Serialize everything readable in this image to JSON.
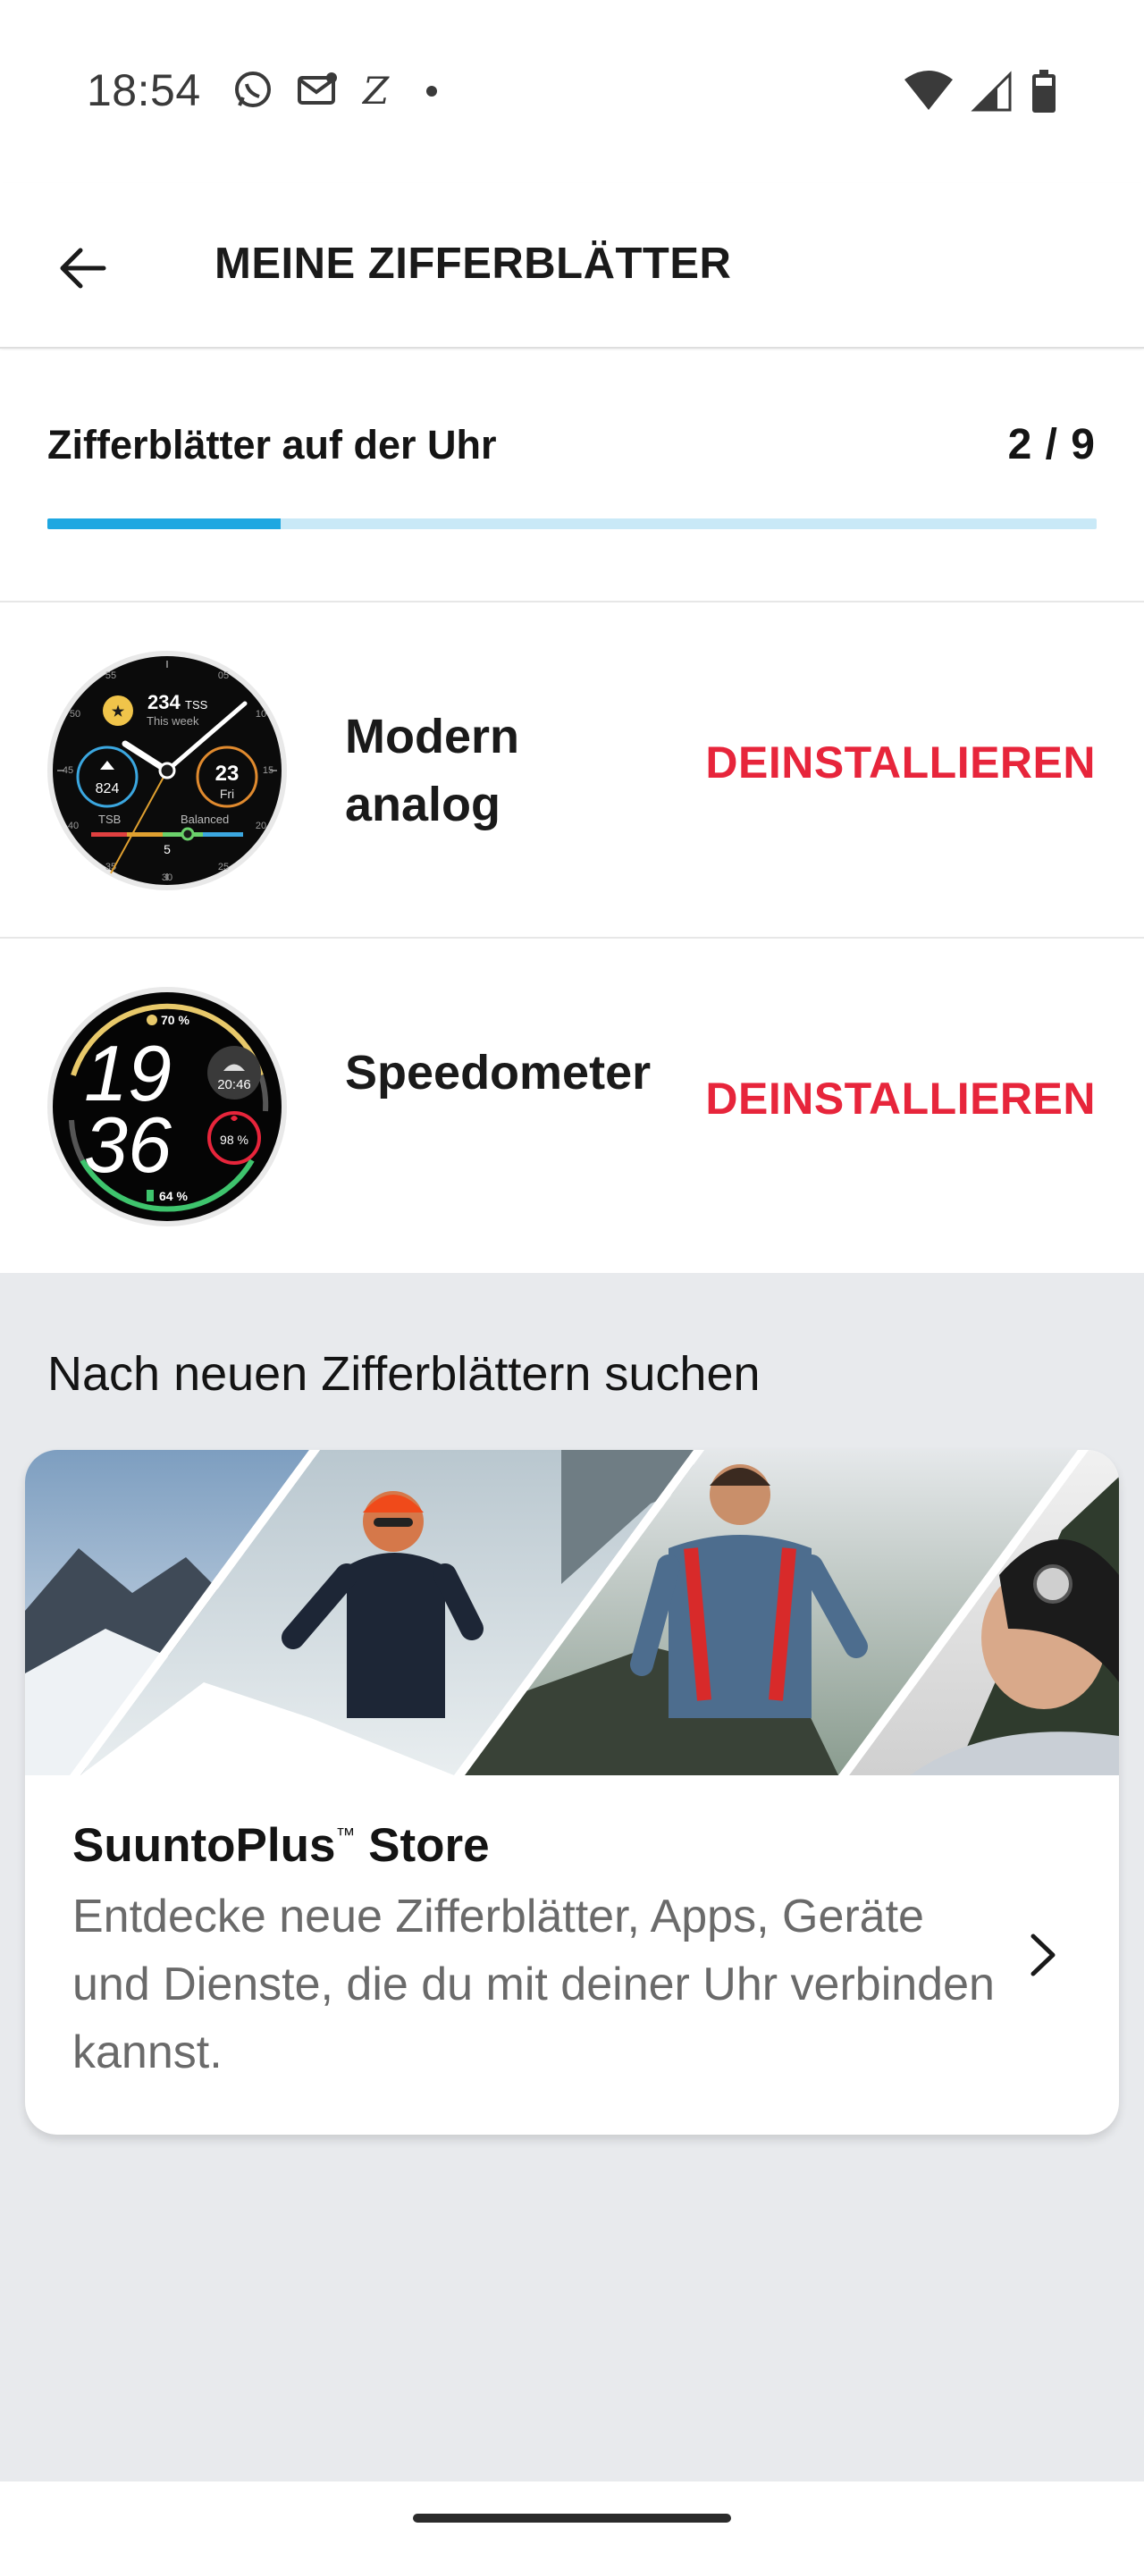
{
  "status_bar": {
    "time": "18:54",
    "left_icons": [
      "whatsapp-icon",
      "mail-icon",
      "z-app-icon",
      "dot-icon"
    ],
    "right_icons": [
      "wifi-icon",
      "signal-icon",
      "battery-icon"
    ]
  },
  "app_bar": {
    "back_icon": "arrow-left-icon",
    "title": "MEINE ZIFFERBLÄTTER"
  },
  "installed": {
    "label": "Zifferblätter auf der Uhr",
    "count": "2 / 9",
    "progress_fraction": 0.222,
    "progress_color": "#1ea7e1",
    "track_color": "#c9e9f7"
  },
  "watch_faces": [
    {
      "name": "Modern analog",
      "action": "DEINSTALLIEREN",
      "face": {
        "tss": "234",
        "tss_unit": "TSS",
        "tss_sub": "This week",
        "left_value": "824",
        "date_day": "23",
        "date_weekday": "Fri",
        "tsb_label": "TSB",
        "balanced_label": "Balanced",
        "bottom_value": "5",
        "tick_55": "55",
        "tick_05": "05",
        "tick_50": "50",
        "tick_10": "10",
        "tick_15": "15",
        "tick_20": "20",
        "tick_40": "40",
        "tick_45": "45",
        "tick_35": "35",
        "tick_30": "30",
        "tick_25": "25"
      }
    },
    {
      "name": "Speedometer",
      "action": "DEINSTALLIEREN",
      "face": {
        "hour": "19",
        "minute": "36",
        "top_percent": "70 %",
        "sunset_time": "20:46",
        "heart_percent": "98 %",
        "battery_percent": "64 %"
      }
    }
  ],
  "browse": {
    "title": "Nach neuen Zifferblättern suchen",
    "store": {
      "title": "SuuntoPlus",
      "trademark": "™",
      "title_suffix": " Store",
      "description": "Entdecke neue Zifferblätter, Apps, Geräte und Dienste, die du mit deiner Uhr verbinden kannst.",
      "chevron_icon": "chevron-right-icon"
    }
  },
  "colors": {
    "accent_red": "#e7253b",
    "browse_bg": "#e8eaed"
  }
}
